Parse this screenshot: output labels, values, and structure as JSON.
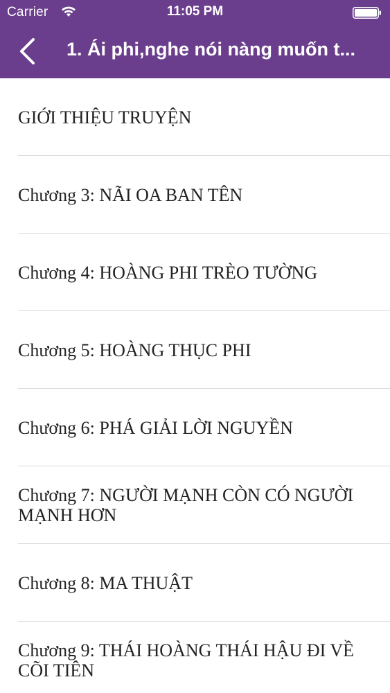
{
  "status_bar": {
    "carrier": "Carrier",
    "time": "11:05 PM"
  },
  "nav": {
    "title": "1. Ái phi,nghe nói nàng muốn t..."
  },
  "chapters": [
    {
      "label": "GIỚI THIỆU TRUYỆN"
    },
    {
      "label": "Chương 3: NÃI OA BAN TÊN"
    },
    {
      "label": "Chương 4: HOÀNG PHI TRÈO TƯỜNG"
    },
    {
      "label": "Chương 5: HOÀNG THỤC PHI"
    },
    {
      "label": "Chương 6: PHÁ GIẢI LỜI NGUYỀN"
    },
    {
      "label": "Chương 7: NGƯỜI MẠNH CÒN CÓ NGƯỜI MẠNH HƠN"
    },
    {
      "label": "Chương 8: MA THUẬT"
    },
    {
      "label": "Chương 9: THÁI HOÀNG THÁI HẬU ĐI VỀ CÕI TIÊN"
    }
  ],
  "colors": {
    "header_background": "#6a3e8c",
    "separator": "#d9d9d9"
  }
}
